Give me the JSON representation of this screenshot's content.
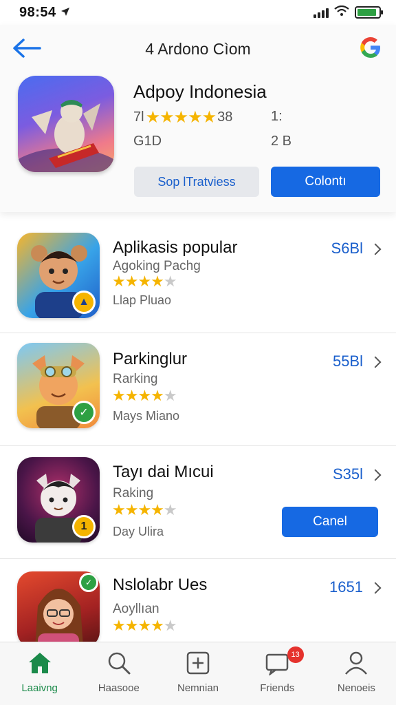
{
  "status_bar": {
    "time": "98:54",
    "battery_level": 0.9
  },
  "header": {
    "title": "4 Ardono Cìom",
    "google_logo": "G"
  },
  "featured_app": {
    "name": "Adpoy Indonesia",
    "rating_prefix": "7l",
    "rating_suffix": "38",
    "stat_right_1": "1:",
    "size": "G1D",
    "stat_right_2": "2 B",
    "secondary_button": "Sop lTratviess",
    "primary_button": "Colontı"
  },
  "apps": [
    {
      "name": "Aplikasis popular",
      "subtitle": "Agoking Pachg",
      "rating": 4.5,
      "meta": "Llap Pluao",
      "price": "S6Bl",
      "icon_colors": [
        "#f5a000",
        "#1f7ad8"
      ]
    },
    {
      "name": "Parkinglur",
      "subtitle": "Rarking",
      "rating": 4.5,
      "meta": "Mays Miano",
      "price": "55Bl",
      "icon_colors": [
        "#6fc3f0",
        "#f3b341"
      ]
    },
    {
      "name": "Tayı dai Mıcui",
      "subtitle": "Raking",
      "rating": 4.5,
      "meta": "Day Ulira",
      "price": "S35l",
      "button": "Canel",
      "icon_colors": [
        "#3a1440",
        "#c9325c"
      ]
    },
    {
      "name": "Nslolabr Ues",
      "subtitle": "Aoyllıan",
      "rating": 4.5,
      "meta": "",
      "price": "1651",
      "icon_colors": [
        "#d8412a",
        "#6a1a18"
      ]
    }
  ],
  "tabs": [
    {
      "label": "Laaivng",
      "icon": "home-icon",
      "active": true
    },
    {
      "label": "Haasooe",
      "icon": "search-icon",
      "active": false
    },
    {
      "label": "Nemnian",
      "icon": "add-square-icon",
      "active": false
    },
    {
      "label": "Friends",
      "icon": "chat-icon",
      "active": false,
      "badge": "13"
    },
    {
      "label": "Nenoeis",
      "icon": "person-icon",
      "active": false
    }
  ],
  "colors": {
    "accent": "#1669e3",
    "star": "#f5b400",
    "active_tab": "#1b8a4a",
    "badge": "#e5322d"
  }
}
